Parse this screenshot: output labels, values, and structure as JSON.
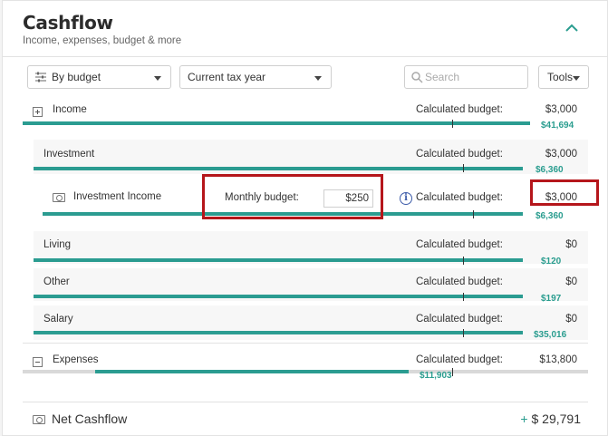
{
  "header": {
    "title": "Cashflow",
    "subtitle": "Income, expenses, budget & more"
  },
  "toolbar": {
    "group_by": "By budget",
    "period": "Current tax year",
    "search_placeholder": "Search",
    "tools_label": "Tools"
  },
  "income": {
    "label": "Income",
    "cb_label": "Calculated budget:",
    "cb_value": "$3,000",
    "actual": "$41,694",
    "rows": [
      {
        "label": "Investment",
        "cb_label": "Calculated budget:",
        "cb_value": "$3,000",
        "actual": "$6,360"
      },
      {
        "label": "Investment Income",
        "monthly_label": "Monthly budget:",
        "monthly_value": "$250",
        "cb_label": "Calculated budget:",
        "cb_value": "$3,000",
        "actual": "$6,360"
      },
      {
        "label": "Living",
        "cb_label": "Calculated budget:",
        "cb_value": "$0",
        "actual": "$120"
      },
      {
        "label": "Other",
        "cb_label": "Calculated budget:",
        "cb_value": "$0",
        "actual": "$197"
      },
      {
        "label": "Salary",
        "cb_label": "Calculated budget:",
        "cb_value": "$0",
        "actual": "$35,016"
      }
    ]
  },
  "expenses": {
    "label": "Expenses",
    "cb_label": "Calculated budget:",
    "cb_value": "$13,800",
    "actual": "$11,903"
  },
  "net": {
    "label": "Net Cashflow",
    "sign": "+",
    "value": "$ 29,791"
  },
  "colors": {
    "bar": "#2b9c91",
    "highlight": "#b5161b"
  },
  "icons": [
    "chevron-up-icon",
    "sliders-icon",
    "search-icon",
    "plus-box-icon",
    "minus-box-icon",
    "money-icon",
    "info-icon"
  ]
}
